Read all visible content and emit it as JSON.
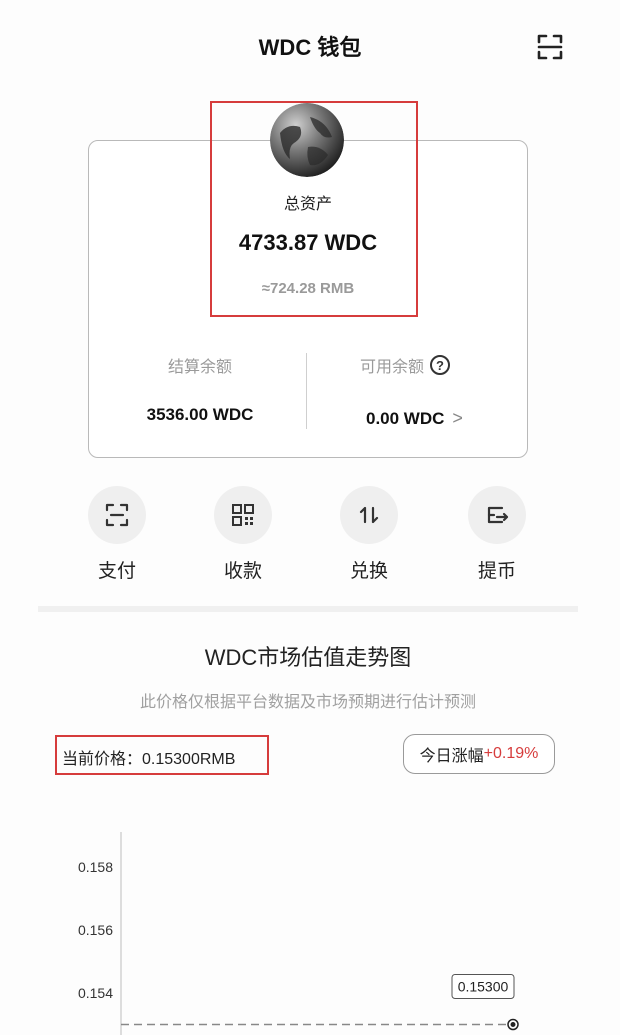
{
  "header": {
    "title": "WDC 钱包",
    "scan_icon": "scan-icon"
  },
  "assets": {
    "total_label": "总资产",
    "total_amount": "4733.87 WDC",
    "total_rmb": "≈724.28 RMB",
    "settlement_label": "结算余额",
    "settlement_amount": "3536.00 WDC",
    "available_label": "可用余额",
    "available_amount": "0.00 WDC",
    "help_icon": "?",
    "chevron": ">"
  },
  "actions": [
    {
      "label": "支付",
      "icon": "scan-icon"
    },
    {
      "label": "收款",
      "icon": "qr-code-icon"
    },
    {
      "label": "兑换",
      "icon": "exchange-icon"
    },
    {
      "label": "提币",
      "icon": "withdraw-icon"
    }
  ],
  "market": {
    "title": "WDC市场估值走势图",
    "subtitle": "此价格仅根据平台数据及市场预期进行估计预测",
    "current_price": "当前价格：0.15300RMB",
    "change_label": "今日涨幅",
    "change_value": "+0.19%"
  },
  "chart_data": {
    "type": "line",
    "y_ticks": [
      "0.158",
      "0.156",
      "0.154"
    ],
    "ylim": [
      0.152,
      0.16
    ],
    "x": [
      0,
      1
    ],
    "values": [
      0.153,
      0.153
    ],
    "point_label": "0.15300"
  }
}
